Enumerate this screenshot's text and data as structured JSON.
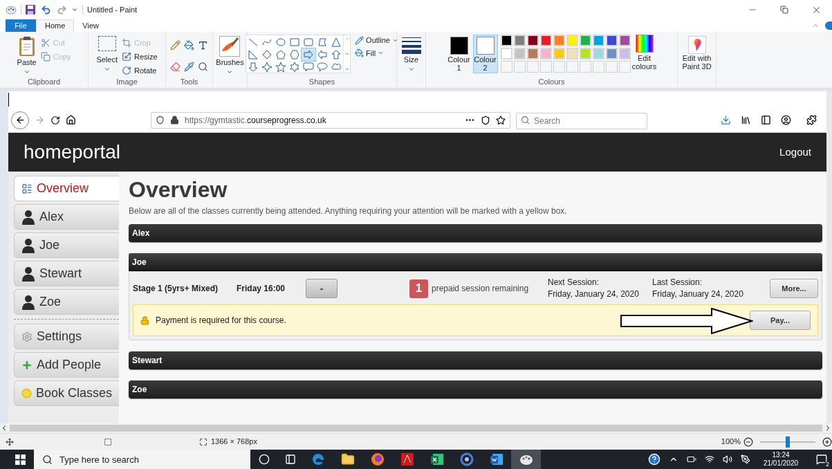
{
  "window": {
    "title": "Untitled - Paint"
  },
  "ribbon_tabs": [
    {
      "label": "File",
      "kind": "file",
      "selected": false
    },
    {
      "label": "Home",
      "kind": "tab",
      "selected": true
    },
    {
      "label": "View",
      "kind": "tab",
      "selected": false
    }
  ],
  "ribbon": {
    "clipboard": {
      "title": "Clipboard",
      "paste": "Paste",
      "actions": [
        {
          "label": "Cut",
          "kind": "cut",
          "disabled": true
        },
        {
          "label": "Copy",
          "kind": "copy",
          "disabled": true
        }
      ]
    },
    "image": {
      "title": "Image",
      "select": "Select",
      "actions": [
        {
          "label": "Crop",
          "kind": "crop",
          "disabled": true
        },
        {
          "label": "Resize",
          "kind": "resize",
          "disabled": false
        },
        {
          "label": "Rotate",
          "kind": "rotate",
          "disabled": false
        }
      ]
    },
    "tools": {
      "title": "Tools"
    },
    "brushes": {
      "label": "Brushes"
    },
    "shapes": {
      "title": "Shapes",
      "outline": "Outline",
      "fill": "Fill",
      "items": [
        {
          "selected": false
        },
        {
          "selected": false
        },
        {
          "selected": false
        },
        {
          "selected": false
        },
        {
          "selected": false
        },
        {
          "selected": false
        },
        {
          "selected": false
        },
        {
          "selected": false
        },
        {
          "selected": false
        },
        {
          "selected": false
        },
        {
          "selected": false
        },
        {
          "selected": true
        },
        {
          "selected": false
        },
        {
          "selected": false
        },
        {
          "selected": false
        },
        {
          "selected": false
        },
        {
          "selected": false
        },
        {
          "selected": false
        },
        {
          "selected": false
        },
        {
          "selected": false
        },
        {
          "selected": false
        }
      ]
    },
    "size": {
      "label": "Size"
    },
    "colours": {
      "title": "Colours",
      "edit": "Edit colours",
      "slots": [
        {
          "label": "Colour 1",
          "color": "#000000",
          "selected": false
        },
        {
          "label": "Colour 2",
          "color": "#ffffff",
          "selected": true
        }
      ],
      "palette": [
        {
          "color": "#000000"
        },
        {
          "color": "#7f7f7f"
        },
        {
          "color": "#880015"
        },
        {
          "color": "#ed1c24"
        },
        {
          "color": "#ff7f27"
        },
        {
          "color": "#fff200"
        },
        {
          "color": "#22b14c"
        },
        {
          "color": "#00a2e8"
        },
        {
          "color": "#3f48cc"
        },
        {
          "color": "#a349a4"
        },
        {
          "color": "#ffffff"
        },
        {
          "color": "#c3c3c3"
        },
        {
          "color": "#b97a57"
        },
        {
          "color": "#ffaec9"
        },
        {
          "color": "#ffc90e"
        },
        {
          "color": "#efe4b0"
        },
        {
          "color": "#b5e61d"
        },
        {
          "color": "#99d9ea"
        },
        {
          "color": "#7092be"
        },
        {
          "color": "#c8bfe7"
        }
      ]
    },
    "paint3d": {
      "label": "Edit with Paint 3D"
    }
  },
  "browser": {
    "url": {
      "prefix": "https://gymtastic.",
      "domain": "courseprogress.co.uk"
    },
    "search": {
      "placeholder": "Search"
    }
  },
  "site": {
    "brand": "homeportal",
    "logout": "Logout",
    "nav_groups": [
      {
        "items": [
          {
            "label": "Overview",
            "kind": "overview",
            "selected": true
          },
          {
            "label": "Alex",
            "kind": "person",
            "selected": false
          },
          {
            "label": "Joe",
            "kind": "person",
            "selected": false
          },
          {
            "label": "Stewart",
            "kind": "person",
            "selected": false
          },
          {
            "label": "Zoe",
            "kind": "person",
            "selected": false
          }
        ]
      },
      {
        "items": [
          {
            "label": "Settings",
            "kind": "settings",
            "selected": false
          },
          {
            "label": "Add People",
            "kind": "add",
            "selected": false
          },
          {
            "label": "Book Classes",
            "kind": "book",
            "selected": false
          }
        ]
      }
    ],
    "page": {
      "title": "Overview",
      "intro": "Below are all of the classes currently being attended. Anything requiring your attention will be marked with a yellow box.",
      "sections": [
        {
          "name": "Alex",
          "expanded": false
        },
        {
          "name": "Joe",
          "expanded": true,
          "classes": [
            {
              "name": "Stage 1 (5yrs+ Mixed)",
              "time": "Friday 16:00",
              "toggle": "-",
              "count": "1",
              "count_text": "prepaid session remaining",
              "next_label": "Next Session:",
              "next": "Friday, January 24, 2020",
              "last_label": "Last Session:",
              "last": "Friday, January 24, 2020",
              "more": "More...",
              "alert": {
                "text": "Payment is required for this course.",
                "action": "Pay..."
              }
            }
          ]
        },
        {
          "name": "Stewart",
          "expanded": false
        },
        {
          "name": "Zoe",
          "expanded": false
        }
      ]
    }
  },
  "status_bar": {
    "dimensions": "1366 × 768px",
    "zoom": "100%",
    "level": 0.5
  },
  "taskbar": {
    "search_placeholder": "Type here to search",
    "apps": [
      {
        "kind": "edge",
        "active": false
      },
      {
        "kind": "explorer",
        "active": false
      },
      {
        "kind": "firefox",
        "active": false
      },
      {
        "kind": "acrobat",
        "active": false
      },
      {
        "kind": "excel",
        "active": false
      },
      {
        "kind": "ring",
        "active": false
      },
      {
        "kind": "word",
        "active": false
      },
      {
        "kind": "paint",
        "active": true
      }
    ],
    "time": "13:24",
    "date": "21/01/2020",
    "notifications": "2"
  }
}
